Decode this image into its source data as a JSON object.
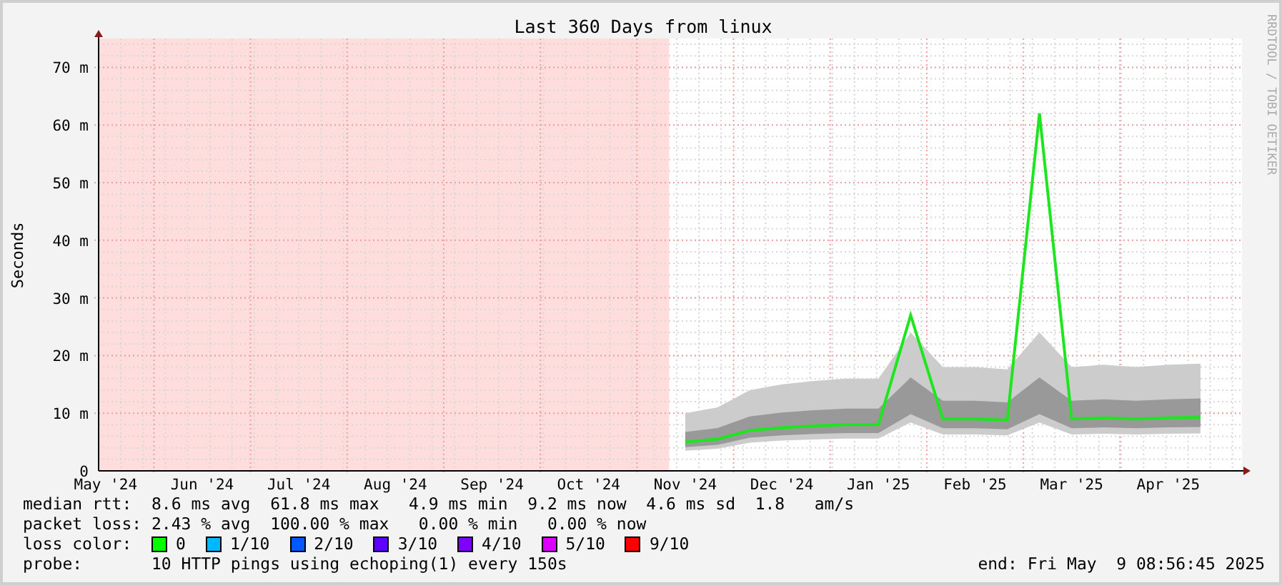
{
  "graph": {
    "side_label": "RRDTOOL / TOBI OETIKER",
    "chart_data": {
      "type": "line",
      "title": "Last 360 Days from linux",
      "ylabel": "Seconds",
      "grid": true,
      "ylim": [
        0,
        75
      ],
      "categories": [
        null,
        "May '24",
        null,
        null,
        "Jun '24",
        null,
        null,
        "Jul '24",
        null,
        null,
        "Aug '24",
        null,
        null,
        "Sep '24",
        null,
        null,
        "Oct '24",
        null,
        null,
        "Nov '24",
        null,
        null,
        "Dec '24",
        null,
        null,
        "Jan '25",
        null,
        null,
        "Feb '25",
        null,
        null,
        "Mar '25",
        null,
        null,
        "Apr '25",
        null
      ],
      "series": [
        {
          "name": "median rtt:",
          "color": "#1ee61e",
          "values": [
            null,
            null,
            null,
            null,
            null,
            null,
            null,
            null,
            null,
            null,
            null,
            null,
            null,
            null,
            null,
            null,
            null,
            null,
            null,
            5,
            5.5,
            7,
            7.5,
            7.8,
            8,
            8,
            27,
            9,
            9,
            8.8,
            62,
            9,
            9.2,
            9,
            9.2,
            9.3
          ]
        }
      ],
      "yticks": [
        {
          "value": 0,
          "label": "0"
        },
        {
          "value": 10,
          "label": "10 m"
        },
        {
          "value": 20,
          "label": "20 m"
        },
        {
          "value": 30,
          "label": "30 m"
        },
        {
          "value": 40,
          "label": "40 m"
        },
        {
          "value": 50,
          "label": "50 m"
        },
        {
          "value": 60,
          "label": "60 m"
        },
        {
          "value": 70,
          "label": "70 m"
        }
      ]
    }
  },
  "legend": {
    "rows": [
      {
        "text": "8.6 ms avg  61.8 ms max   4.9 ms min  9.2 ms now  4.6 ms sd  1.8   am/s"
      },
      {
        "label": "packet loss:",
        "text": "2.43 % avg  100.00 % max   0.00 % min   0.00 % now"
      }
    ],
    "loss_color": {
      "label": "loss color:",
      "items": [
        {
          "label": "0",
          "color": "#00ff00"
        },
        {
          "label": "1/10",
          "color": "#00b8ff"
        },
        {
          "label": "2/10",
          "color": "#0059ff"
        },
        {
          "label": "3/10",
          "color": "#5e00ff"
        },
        {
          "label": "4/10",
          "color": "#7e00ff"
        },
        {
          "label": "5/10",
          "color": "#dd00ff"
        },
        {
          "label": "9/10",
          "color": "#ff0000"
        }
      ]
    },
    "probe": {
      "label": "probe:",
      "text": "10 HTTP pings using echoping(1) every 150s"
    },
    "end": "end: Fri May  9 08:56:45 2025"
  }
}
